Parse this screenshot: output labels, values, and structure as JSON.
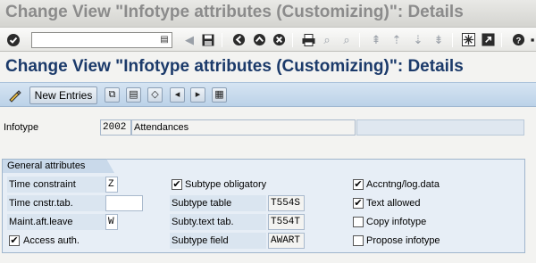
{
  "window": {
    "title": "Change View \"Infotype attributes (Customizing)\": Details"
  },
  "toolbar": {
    "command_field_value": "",
    "icons": [
      "enter-icon",
      "command-dropdown-icon",
      "back-arrow-icon",
      "save-icon",
      "back-icon",
      "exit-icon",
      "cancel-icon",
      "print-icon",
      "find-icon",
      "find-next-icon",
      "first-page-icon",
      "previous-page-icon",
      "next-page-icon",
      "last-page-icon",
      "create-session-icon",
      "shortcut-icon",
      "help-icon"
    ]
  },
  "screen": {
    "title": "Change View \"Infotype attributes (Customizing)\": Details"
  },
  "app_toolbar": {
    "new_entries_label": "New Entries",
    "icons": [
      "display-change-icon",
      "copy-as-icon",
      "delete-icon",
      "undo-icon",
      "previous-entry-icon",
      "next-entry-icon",
      "select-all-icon"
    ]
  },
  "infotype": {
    "label": "Infotype",
    "code": "2002",
    "name": "Attendances",
    "extra": ""
  },
  "group": {
    "title": "General attributes",
    "time_constraint": {
      "label": "Time constraint",
      "value": "Z"
    },
    "time_cnstr_tab": {
      "label": "Time cnstr.tab.",
      "value": ""
    },
    "maint_aft_leave": {
      "label": "Maint.aft.leave",
      "value": "W"
    },
    "access_auth": {
      "label": "Access auth.",
      "checked": true,
      "mark": "✔"
    },
    "subtype_obligatory": {
      "label": "Subtype obligatory",
      "checked": true,
      "mark": "✔"
    },
    "subtype_table": {
      "label": "Subtype table",
      "value": "T554S"
    },
    "subty_text_tab": {
      "label": "Subty.text tab.",
      "value": "T554T"
    },
    "subtype_field": {
      "label": "Subtype field",
      "value": "AWART"
    },
    "accntng_log_data": {
      "label": "Accntng/log.data",
      "checked": true,
      "mark": "✔"
    },
    "text_allowed": {
      "label": "Text allowed",
      "checked": true,
      "mark": "✔"
    },
    "copy_infotype": {
      "label": "Copy infotype",
      "checked": false,
      "mark": ""
    },
    "propose_infotype": {
      "label": "Propose infotype",
      "checked": false,
      "mark": ""
    }
  }
}
